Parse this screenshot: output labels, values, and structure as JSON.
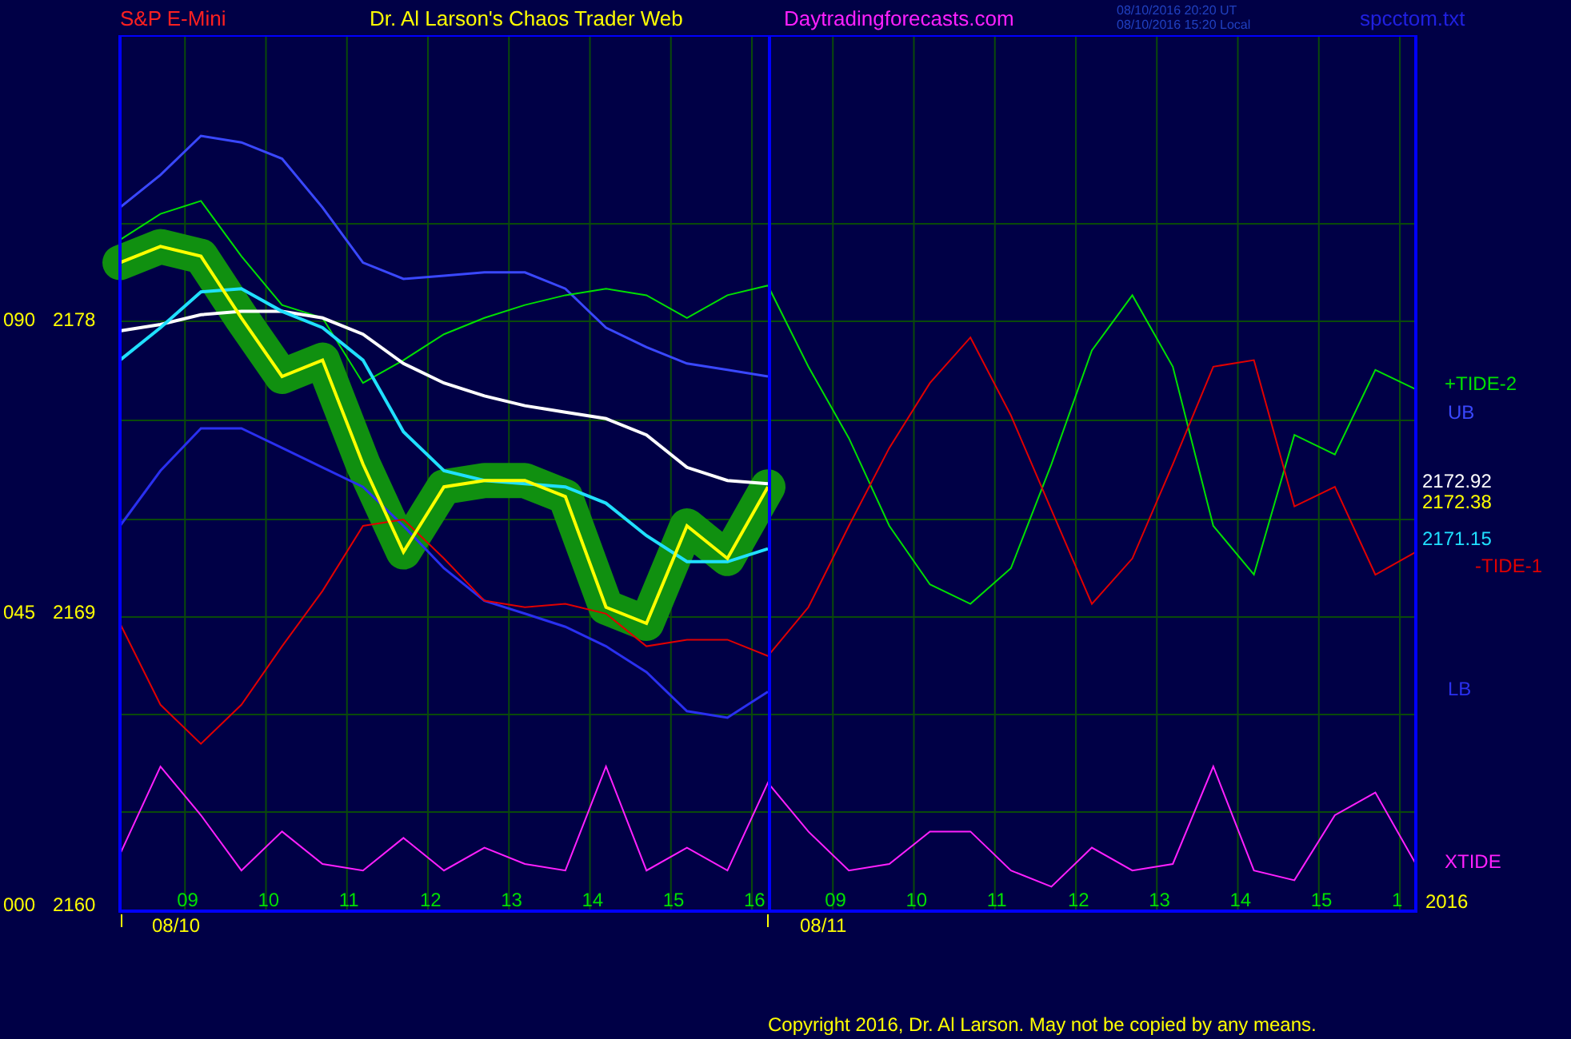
{
  "header": {
    "instrument": "S&P E-Mini",
    "title": "Dr. Al Larson's Chaos Trader Web",
    "website": "Daytradingforecasts.com",
    "timestamps": [
      "08/10/2016 20:20 UT",
      "08/10/2016 15:20 Local"
    ],
    "file": "spcctom.txt"
  },
  "chart": {
    "date_labels": [
      "08/10",
      "08/11"
    ],
    "angle_labels": [
      "090",
      "045",
      "000"
    ],
    "year": "2016",
    "chart_data": {
      "type": "line",
      "categories": [
        null,
        null,
        "09",
        null,
        "10",
        null,
        "11",
        null,
        "12",
        null,
        "13",
        null,
        "14",
        null,
        "15",
        null,
        "16",
        null,
        "09",
        null,
        "10",
        null,
        "11",
        null,
        "12",
        null,
        "13",
        null,
        "14",
        null,
        "15",
        null,
        "1"
      ],
      "ylim": [
        2159.75,
        2186.7
      ],
      "grid": true,
      "yticks": [
        2178,
        2169,
        2160
      ],
      "series": [
        {
          "name": "UB",
          "color": "#3a48ff",
          "values": [
            2181.4,
            2182.4,
            2183.6,
            2183.4,
            2182.9,
            2181.4,
            2179.7,
            2179.2,
            2179.3,
            2179.4,
            2179.4,
            2178.9,
            2177.7,
            2177.1,
            2176.6,
            2176.4,
            2176.2,
            null,
            null,
            null,
            null,
            null,
            null,
            null,
            null,
            null,
            null,
            null,
            null,
            null,
            null,
            null,
            null
          ]
        },
        {
          "name": "LB",
          "color": "#2a30f0",
          "values": [
            2171.6,
            2173.3,
            2174.6,
            2174.6,
            2174.0,
            2173.4,
            2172.8,
            2171.6,
            2170.3,
            2169.3,
            2168.9,
            2168.5,
            2167.9,
            2167.1,
            2165.9,
            2165.7,
            2166.5,
            null,
            null,
            null,
            null,
            null,
            null,
            null,
            null,
            null,
            null,
            null,
            null,
            null,
            null,
            null,
            null
          ]
        },
        {
          "name": "+TIDE-2",
          "color": "#00e000",
          "values": [
            2180.4,
            2181.2,
            2181.6,
            2179.9,
            2178.4,
            2178.0,
            2176.0,
            2176.7,
            2177.5,
            2178.0,
            2178.4,
            2178.7,
            2178.9,
            2178.7,
            2178.0,
            2178.7,
            2179.0,
            2176.5,
            2174.3,
            2171.6,
            2169.8,
            2169.2,
            2170.3,
            2173.5,
            2177.0,
            2178.7,
            2176.5,
            2171.6,
            2170.1,
            2174.4,
            2173.8,
            2176.4,
            2175.8
          ]
        },
        {
          "name": "-TIDE-1",
          "color": "#e00000",
          "values": [
            2168.6,
            2166.1,
            2164.9,
            2166.1,
            2167.9,
            2169.6,
            2171.6,
            2171.8,
            2170.6,
            2169.3,
            2169.1,
            2169.2,
            2168.9,
            2167.9,
            2168.1,
            2168.1,
            2167.6,
            2169.1,
            2171.6,
            2174.0,
            2176.0,
            2177.4,
            2175.0,
            2172.1,
            2169.2,
            2170.6,
            2173.5,
            2176.5,
            2176.7,
            2172.2,
            2172.8,
            2170.1,
            2170.8
          ]
        },
        {
          "name": "XTIDE",
          "color": "#ff20ff",
          "values": [
            2161.5,
            2164.2,
            2162.7,
            2161.0,
            2162.2,
            2161.2,
            2161.0,
            2162.0,
            2161.0,
            2161.7,
            2161.2,
            2161.0,
            2164.2,
            2161.0,
            2161.7,
            2161.0,
            2163.7,
            2162.2,
            2161.0,
            2161.2,
            2162.2,
            2162.2,
            2161.0,
            2160.5,
            2161.7,
            2161.0,
            2161.2,
            2164.2,
            2161.0,
            2160.7,
            2162.7,
            2163.4,
            2161.2
          ]
        },
        {
          "name": "2172.92",
          "color": "#ffffff",
          "values": [
            2177.6,
            2177.8,
            2178.1,
            2178.2,
            2178.2,
            2178.0,
            2177.5,
            2176.6,
            2176.0,
            2175.6,
            2175.3,
            2175.1,
            2174.9,
            2174.4,
            2173.4,
            2173.0,
            2172.9,
            null,
            null,
            null,
            null,
            null,
            null,
            null,
            null,
            null,
            null,
            null,
            null,
            null,
            null,
            null,
            null
          ]
        },
        {
          "name": "2171.15",
          "color": "#20e0ff",
          "values": [
            2176.7,
            2177.7,
            2178.8,
            2178.9,
            2178.2,
            2177.7,
            2176.7,
            2174.5,
            2173.3,
            2173.0,
            2172.9,
            2172.8,
            2172.3,
            2171.3,
            2170.5,
            2170.5,
            2170.9,
            null,
            null,
            null,
            null,
            null,
            null,
            null,
            null,
            null,
            null,
            null,
            null,
            null,
            null,
            null,
            null
          ]
        },
        {
          "name": "2172.38",
          "color": "#ffff00",
          "values": [
            2179.7,
            2180.2,
            2179.9,
            2178.0,
            2176.2,
            2176.7,
            2173.5,
            2170.8,
            2172.8,
            2173.0,
            2173.0,
            2172.5,
            2169.1,
            2168.6,
            2171.6,
            2170.6,
            2172.8,
            null,
            null,
            null,
            null,
            null,
            null,
            null,
            null,
            null,
            null,
            null,
            null,
            null,
            null,
            null,
            null
          ]
        }
      ]
    }
  },
  "copyright": "Copyright 2016, Dr. Al Larson. May not be copied by any means."
}
